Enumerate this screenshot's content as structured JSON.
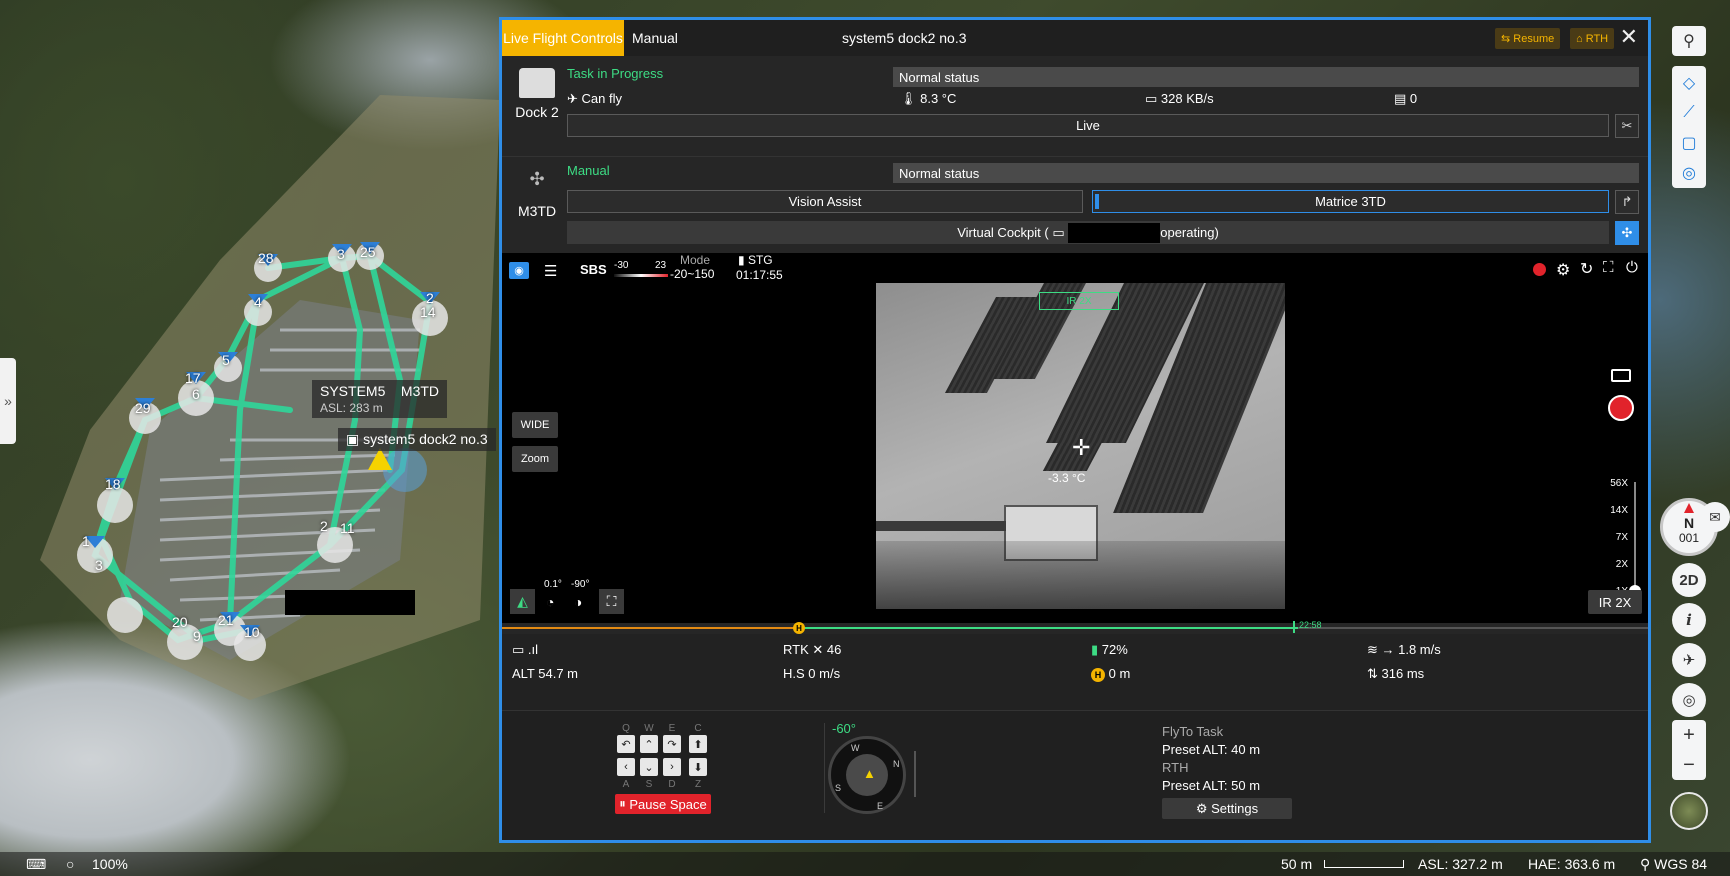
{
  "map": {
    "waypoints": [
      "28",
      "3",
      "25",
      "2",
      "14",
      "4",
      "5",
      "17",
      "6",
      "29",
      "18",
      "1",
      "3",
      "21",
      "20",
      "9",
      "10",
      "11",
      "2"
    ],
    "drone_tag": "SYSTEM5",
    "drone_model": "M3TD",
    "drone_asl": "ASL: 283 m",
    "dock_tag": "system5 dock2 no.3",
    "expand_label": "»"
  },
  "panel": {
    "tabs": {
      "live": "Live Flight Controls",
      "manual": "Manual"
    },
    "title": "system5 dock2 no.3",
    "resume_label": "Resume",
    "rth_label": "RTH",
    "close_label": "✕",
    "dock": {
      "name": "Dock 2",
      "task_status": "Task in Progress",
      "normal_status": "Normal status",
      "can_fly": "Can fly",
      "temperature": "8.3 °C",
      "network": "328 KB/s",
      "storage": "0",
      "live_label": "Live"
    },
    "drone": {
      "name": "M3TD",
      "mode_status": "Manual",
      "normal_status": "Normal status",
      "vision_assist": "Vision Assist",
      "payload": "Matrice 3TD",
      "virtual_cockpit_prefix": "Virtual Cockpit  (",
      "virtual_cockpit_suffix": "operating)"
    },
    "video": {
      "sbs_label": "SBS",
      "sbs_low": "-30",
      "sbs_high": "23",
      "mode_label": "Mode",
      "mode_range": "-20~150",
      "stg_label": "STG",
      "stg_time": "01:17:55",
      "ir_zoom_tag": "IR 2X",
      "spot_temp": "-3.3 °C",
      "wide_label": "WIDE",
      "zoom_label": "Zoom",
      "gimbal_pitch": "0.1°",
      "gimbal_yaw": "-90°",
      "zoom_levels": [
        "56X",
        "14X",
        "7X",
        "2X",
        "1X"
      ],
      "ir_toggle": "IR 2X"
    },
    "timeline": {
      "end_time": "22:58",
      "home_marker": "H"
    },
    "telemetry": {
      "rtk_label": "RTK",
      "rtk_value": "46",
      "battery": "72%",
      "wind": "→ 1.8 m/s",
      "altitude": "ALT 54.7 m",
      "hspeed": "H.S 0 m/s",
      "home_distance": "0 m",
      "latency": "316 ms"
    },
    "controls": {
      "keys_top": [
        "Q",
        "W",
        "E",
        "C"
      ],
      "keys_bottom": [
        "A",
        "S",
        "D",
        "Z"
      ],
      "pause_label": "Pause Space",
      "heading": "-60°",
      "flyto_label": "FlyTo Task",
      "flyto_alt": "Preset ALT: 40 m",
      "rth_label": "RTH",
      "rth_alt": "Preset ALT: 50 m",
      "settings_label": "Settings"
    }
  },
  "toolbar": {
    "compass_letter": "N",
    "compass_value": "001",
    "view_mode": "2D",
    "info_label": "i",
    "zoom_in": "+",
    "zoom_out": "−"
  },
  "statusbar": {
    "zoom_percent": "100%",
    "scale": "50 m",
    "asl": "ASL: 327.2 m",
    "hae": "HAE: 363.6 m",
    "crs": "WGS 84"
  },
  "colors": {
    "accent_blue": "#2f8ee8",
    "live_tab": "#f5b400",
    "ok_green": "#3ddc84",
    "record_red": "#e1232b",
    "route_green": "#2fd79a"
  }
}
